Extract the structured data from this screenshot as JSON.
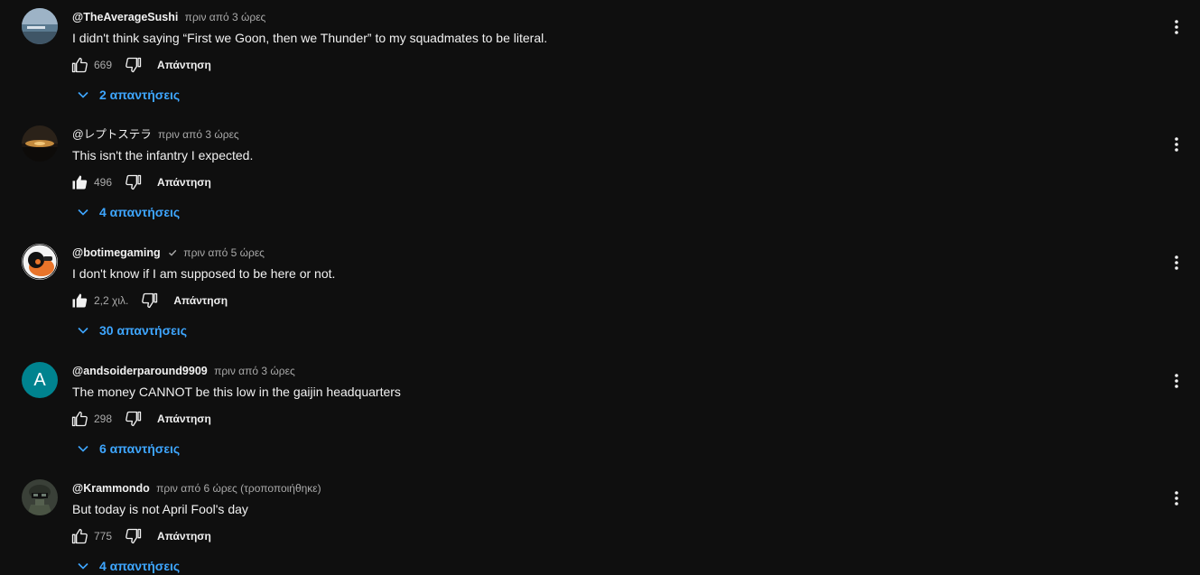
{
  "comments": [
    {
      "author": "@TheAverageSushi",
      "time": "πριν από 3 ώρες",
      "text": "I didn't think saying “First we Goon, then we Thunder” to my squadmates to be literal.",
      "likes": "669",
      "liked": false,
      "reply_label": "Απάντηση",
      "replies_label": "2 απαντήσεις",
      "avatar": "avatar-photo-landscape"
    },
    {
      "author": "@レプトステラ",
      "time": "πριν από 3 ώρες",
      "text": "This isn't the infantry I expected.",
      "likes": "496",
      "liked": true,
      "reply_label": "Απάντηση",
      "replies_label": "4 απαντήσεις",
      "avatar": "avatar-photo-sunset"
    },
    {
      "author": "@botimegaming",
      "verified": true,
      "time": "πριν από 5 ώρες",
      "text": "I don't know if I am supposed to be here or not.",
      "likes": "2,2 χιλ.",
      "liked": true,
      "reply_label": "Απάντηση",
      "replies_label": "30 απαντήσεις",
      "avatar": "avatar-cartoon-character"
    },
    {
      "author": "@andsoiderparound9909",
      "time": "πριν από 3 ώρες",
      "text": "The money CANNOT be this low in the gaijin headquarters",
      "likes": "298",
      "liked": false,
      "reply_label": "Απάντηση",
      "replies_label": "6 απαντήσεις",
      "avatar_letter": "A",
      "avatar_color": "#00838f"
    },
    {
      "author": "@Krammondo",
      "time": "πριν από 6 ώρες (τροποποιήθηκε)",
      "text": "But today is not April Fool's day",
      "likes": "775",
      "liked": false,
      "reply_label": "Απάντηση",
      "replies_label": "4 απαντήσεις",
      "avatar": "avatar-photo-soldier"
    }
  ],
  "colors": {
    "background": "#0f0f0f",
    "text_primary": "#f1f1f1",
    "text_secondary": "#aaaaaa",
    "link_blue": "#3ea6ff"
  }
}
